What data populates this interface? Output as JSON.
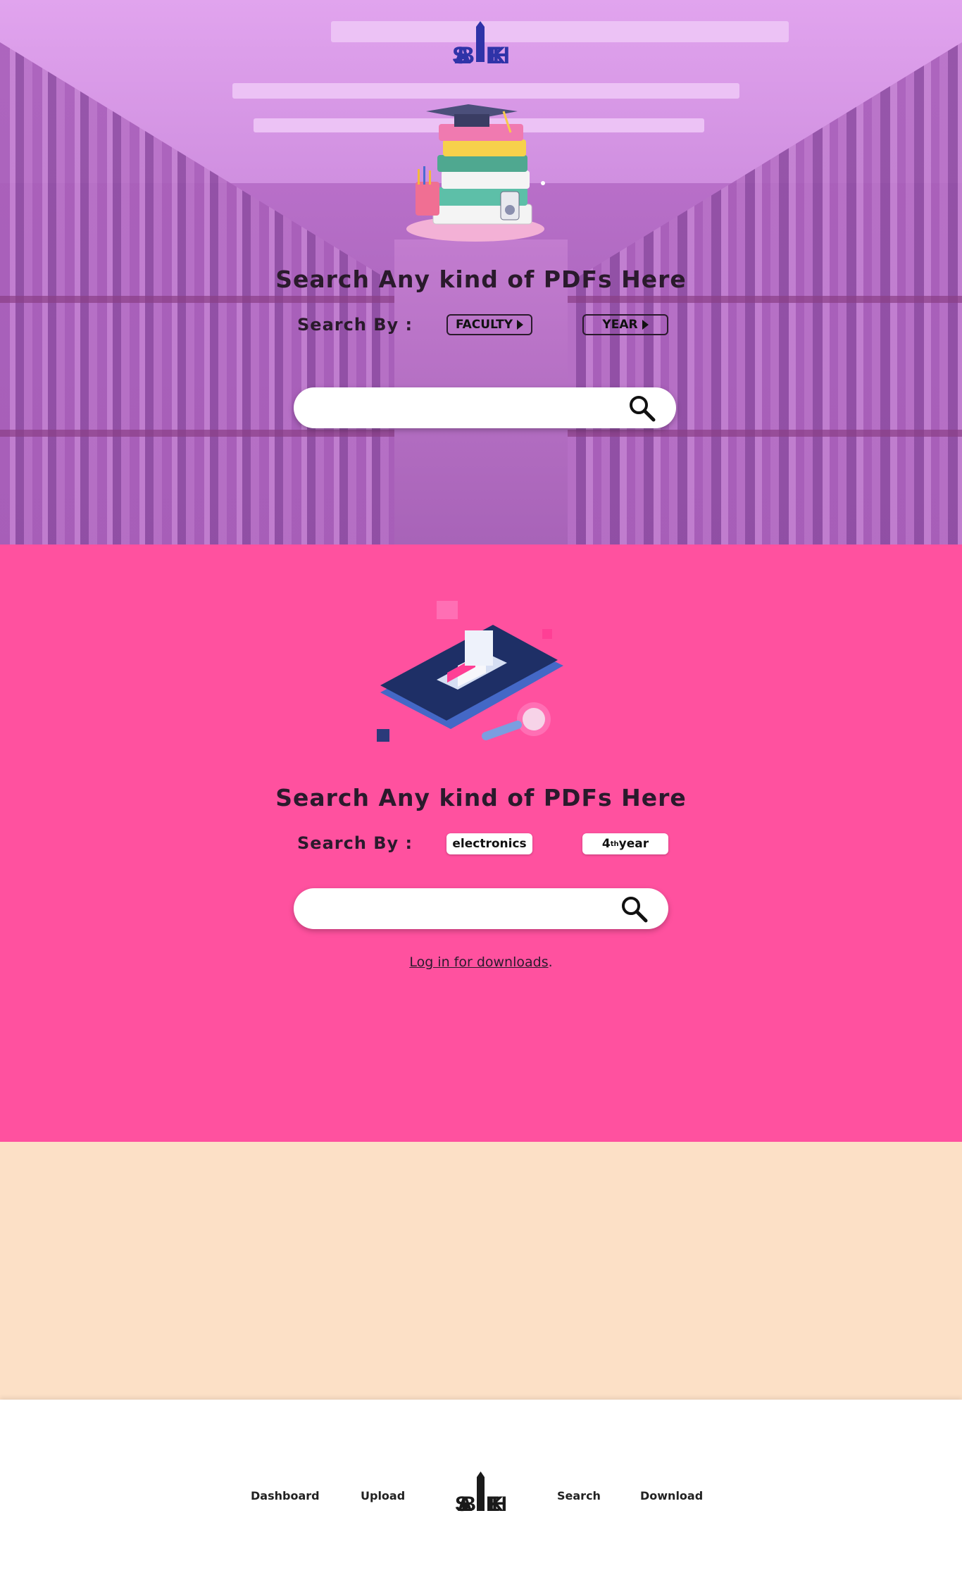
{
  "brand": {
    "logo_text": "SABLEKH",
    "logo_color": "#2f33a8"
  },
  "hero": {
    "headline": "Search Any kind of  PDFs  Here",
    "search_by_label": "Search By :",
    "filters": [
      {
        "label": "FACULTY"
      },
      {
        "label": "YEAR"
      }
    ],
    "search": {
      "placeholder": "",
      "value": ""
    }
  },
  "results": {
    "headline": "Search Any kind of  PDFs  Here",
    "search_by_label": "Search By :",
    "filters": [
      {
        "label": "electronics"
      },
      {
        "label_num": "4",
        "label_sup": "th",
        "label_rest": "year"
      }
    ],
    "search": {
      "placeholder": "",
      "value": ""
    },
    "login_link": "Log in for downloads",
    "login_suffix": "."
  },
  "footer": {
    "nav": [
      "Dashboard",
      "Upload",
      "Search",
      "Download"
    ],
    "logo_text": "SABLEKH"
  },
  "colors": {
    "pink": "#ff519f",
    "peach": "#fce0c6",
    "hero_tint": "#c878d8"
  },
  "icons": [
    "logo-icon",
    "books-illustration",
    "triangle-right-icon",
    "search-icon",
    "phone-library-illustration"
  ]
}
